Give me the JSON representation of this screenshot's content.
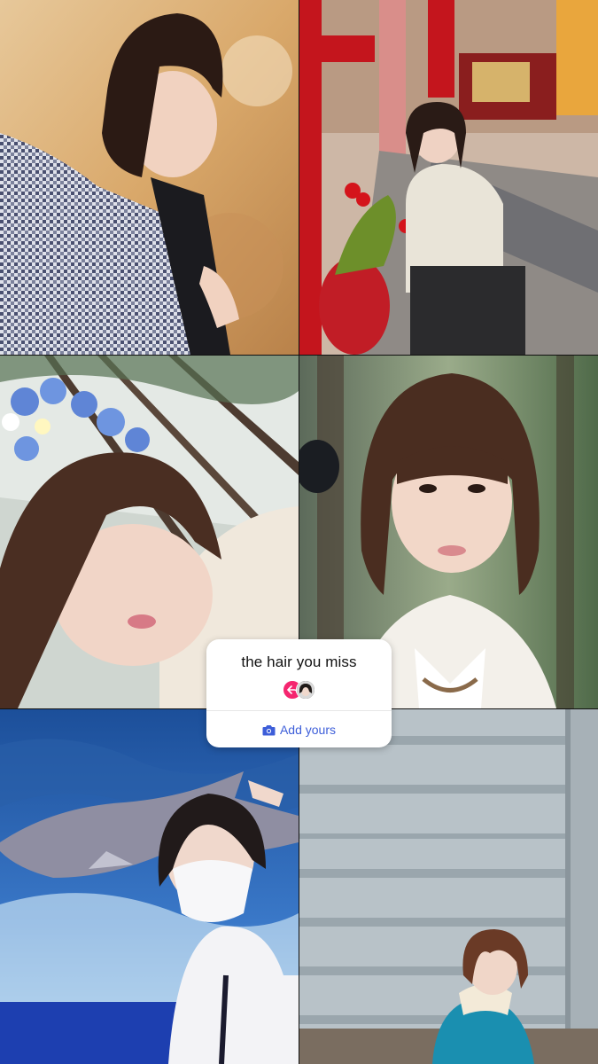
{
  "collage": {
    "tiles": [
      {
        "id": "photo-1",
        "icon": "photo"
      },
      {
        "id": "photo-2",
        "icon": "photo"
      },
      {
        "id": "photo-3",
        "icon": "photo"
      },
      {
        "id": "photo-4",
        "icon": "photo"
      },
      {
        "id": "photo-5",
        "icon": "photo"
      },
      {
        "id": "photo-6",
        "icon": "photo"
      }
    ]
  },
  "sticker": {
    "prompt": "the hair you miss",
    "button_label": "Add yours",
    "icons": {
      "reply": "reply-arrow-icon",
      "camera": "camera-icon"
    },
    "colors": {
      "accent": "#3d5ed9",
      "badge": "#f5256f",
      "background": "#ffffff"
    }
  }
}
